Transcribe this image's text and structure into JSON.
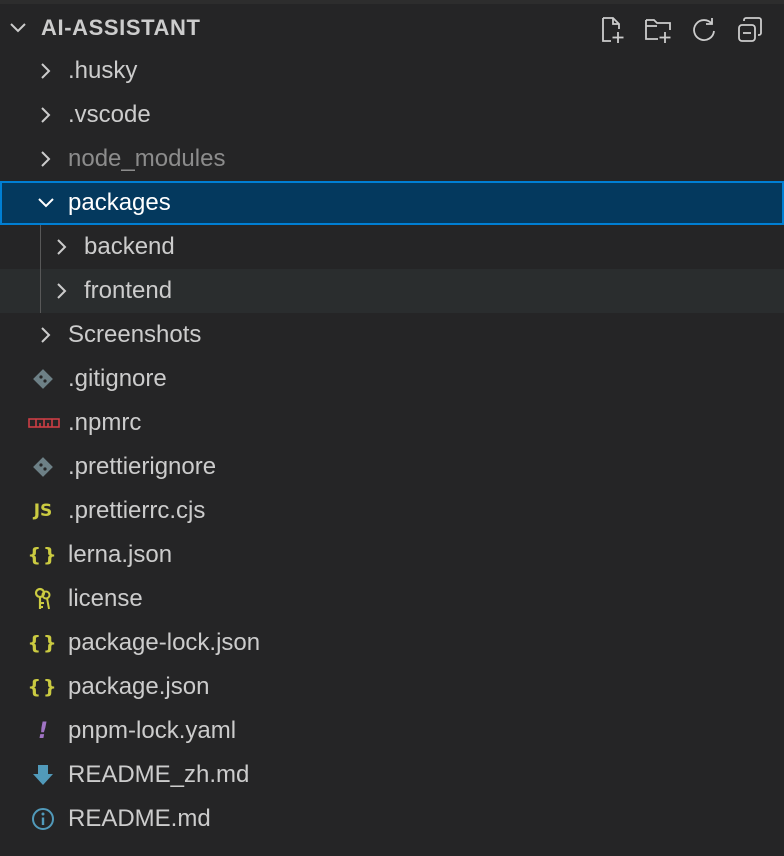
{
  "explorer": {
    "section_title": "AI-ASSISTANT",
    "actions": [
      {
        "name": "new-file-button",
        "icon": "new-file-icon"
      },
      {
        "name": "new-folder-button",
        "icon": "new-folder-icon"
      },
      {
        "name": "refresh-button",
        "icon": "refresh-icon"
      },
      {
        "name": "collapse-all-button",
        "icon": "collapse-all-icon"
      }
    ],
    "items": [
      {
        "label": ".husky",
        "kind": "folder",
        "expanded": false
      },
      {
        "label": ".vscode",
        "kind": "folder",
        "expanded": false
      },
      {
        "label": "node_modules",
        "kind": "folder",
        "expanded": false,
        "dimmed": true
      },
      {
        "label": "packages",
        "kind": "folder",
        "expanded": true,
        "selected": true
      },
      {
        "label": "backend",
        "kind": "folder",
        "expanded": false
      },
      {
        "label": "frontend",
        "kind": "folder",
        "expanded": false,
        "hovered": true
      },
      {
        "label": "Screenshots",
        "kind": "folder",
        "expanded": false
      },
      {
        "label": ".gitignore",
        "kind": "file",
        "icon": "git-icon"
      },
      {
        "label": ".npmrc",
        "kind": "file",
        "icon": "npm-icon"
      },
      {
        "label": ".prettierignore",
        "kind": "file",
        "icon": "git-icon"
      },
      {
        "label": ".prettierrc.cjs",
        "kind": "file",
        "icon": "javascript-icon",
        "icon_text": "JS"
      },
      {
        "label": "lerna.json",
        "kind": "file",
        "icon": "json-icon",
        "icon_text": "{}"
      },
      {
        "label": "license",
        "kind": "file",
        "icon": "license-key-icon"
      },
      {
        "label": "package-lock.json",
        "kind": "file",
        "icon": "json-icon",
        "icon_text": "{}"
      },
      {
        "label": "package.json",
        "kind": "file",
        "icon": "json-icon",
        "icon_text": "{}"
      },
      {
        "label": "pnpm-lock.yaml",
        "kind": "file",
        "icon": "yaml-icon",
        "icon_text": "!"
      },
      {
        "label": "README_zh.md",
        "kind": "file",
        "icon": "markdown-download-icon"
      },
      {
        "label": "README.md",
        "kind": "file",
        "icon": "info-icon"
      }
    ]
  },
  "colors": {
    "background": "#252526",
    "selection_bg": "#04395e",
    "selection_border": "#007fd4",
    "hover_bg": "#2a2d2e",
    "json_yellow": "#cbcb41",
    "js_yellow": "#cbcb41",
    "git_gray": "#6d8086",
    "npm_red": "#cc3e44",
    "yaml_purple": "#a074c4",
    "md_blue": "#519aba",
    "key_yellow": "#cbcb41"
  }
}
